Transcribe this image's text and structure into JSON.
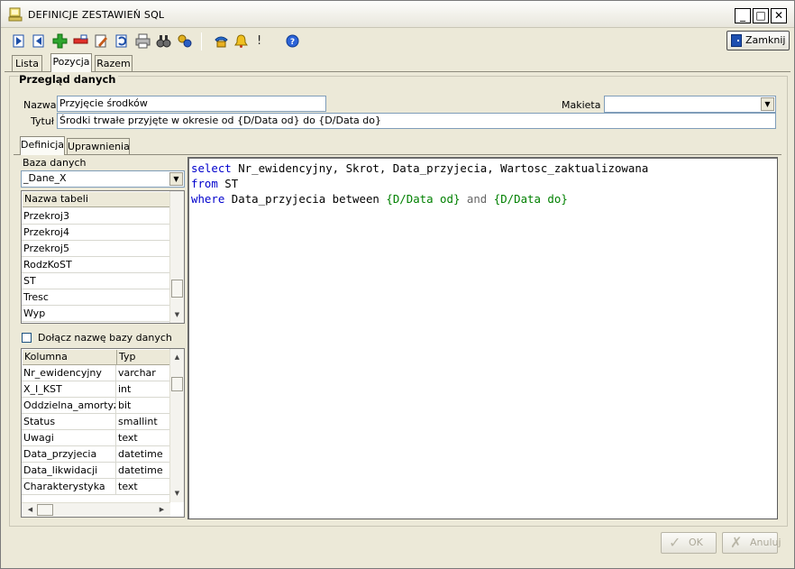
{
  "window": {
    "title": "DEFINICJE ZESTAWIEŃ SQL",
    "controls": {
      "minimize": "_",
      "maximize": "□",
      "close": "✕"
    }
  },
  "toolbar": {
    "icons": [
      "first-record-icon",
      "prev-record-icon",
      "add-icon",
      "delete-icon",
      "edit-icon",
      "refresh-icon",
      "print-icon",
      "find-icon",
      "settings-icon",
      "phone-icon",
      "bell-icon",
      "exclamation-icon",
      "help-icon"
    ],
    "exclamation": "!",
    "close_label": "Zamknij"
  },
  "main_tabs": [
    "Lista",
    "Pozycja",
    "Razem"
  ],
  "main_tab_active": "Pozycja",
  "group": {
    "title": "Przegląd danych",
    "nazwa_label": "Nazwa",
    "nazwa_value": "Przyjęcie środków",
    "makieta_label": "Makieta",
    "makieta_value": "",
    "tytul_label": "Tytuł",
    "tytul_value": "Środki trwałe przyjęte w okresie od {D/Data od} do {D/Data do}"
  },
  "sub_tabs": [
    "Definicja",
    "Uprawnienia"
  ],
  "sub_tab_active": "Definicja",
  "database": {
    "label": "Baza danych",
    "value": "_Dane_X"
  },
  "tables": {
    "header": "Nazwa tabeli",
    "rows": [
      "Przekroj3",
      "Przekroj4",
      "Przekroj5",
      "RodzKoST",
      "ST",
      "Tresc",
      "Wyp"
    ]
  },
  "append_db_name": {
    "label": "Dołącz nazwę bazy danych",
    "checked": false
  },
  "columns": {
    "headers": [
      "Kolumna",
      "Typ"
    ],
    "rows": [
      [
        "Nr_ewidencyjny",
        "varchar"
      ],
      [
        "X_I_KST",
        "int"
      ],
      [
        "Oddzielna_amortyzacja",
        "bit"
      ],
      [
        "Status",
        "smallint"
      ],
      [
        "Uwagi",
        "text"
      ],
      [
        "Data_przyjecia",
        "datetime"
      ],
      [
        "Data_likwidacji",
        "datetime"
      ],
      [
        "Charakterystyka",
        "text"
      ]
    ]
  },
  "sql": {
    "l1_kw": "select",
    "l1_rest": " Nr_ewidencyjny, Skrot, Data_przyjecia, Wartosc_zaktualizowana",
    "l2_kw": "from",
    "l2_rest": " ST",
    "l3_kw": "where",
    "l3_mid": " Data_przyjecia between ",
    "l3_p1": "{D/Data od}",
    "l3_and": " and ",
    "l3_p2": "{D/Data do}"
  },
  "footer": {
    "ok_label": "OK",
    "cancel_label": "Anuluj"
  }
}
